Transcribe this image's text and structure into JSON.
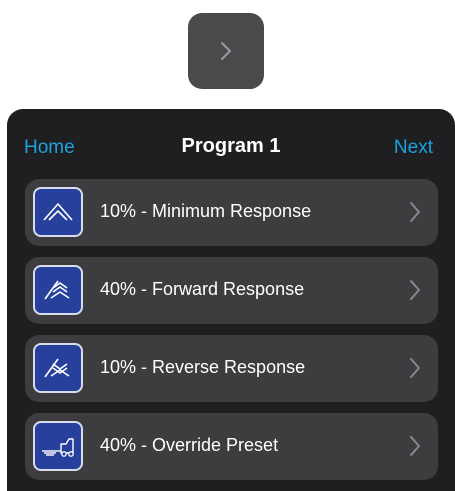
{
  "header": {
    "home_label": "Home",
    "title": "Program 1",
    "next_label": "Next"
  },
  "items": [
    {
      "label": "10% - Minimum Response",
      "icon": "minimum-response-icon"
    },
    {
      "label": "40% - Forward Response",
      "icon": "forward-response-icon"
    },
    {
      "label": "10% - Reverse Response",
      "icon": "reverse-response-icon"
    },
    {
      "label": "40% - Override Preset",
      "icon": "override-preset-icon"
    }
  ],
  "colors": {
    "accent": "#1aa3df",
    "panel_bg": "#1f1f21",
    "row_bg": "#3d3d40",
    "icon_tile_bg": "#27409b",
    "top_button_bg": "#4a4a4c"
  }
}
